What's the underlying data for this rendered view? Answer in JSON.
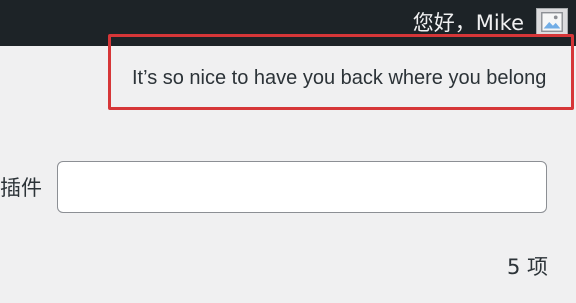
{
  "admin_bar": {
    "greeting": "您好，Mike",
    "avatar_icon": "avatar-placeholder-icon"
  },
  "notice": {
    "text": "It’s so nice to have you back where you belong",
    "outline_color": "#d63638"
  },
  "search": {
    "label": "插件",
    "value": "",
    "placeholder": ""
  },
  "list": {
    "count_text": "5 项"
  },
  "colors": {
    "admin_bar_bg": "#1d2327",
    "page_bg": "#f0f0f1",
    "text": "#2c3338"
  }
}
